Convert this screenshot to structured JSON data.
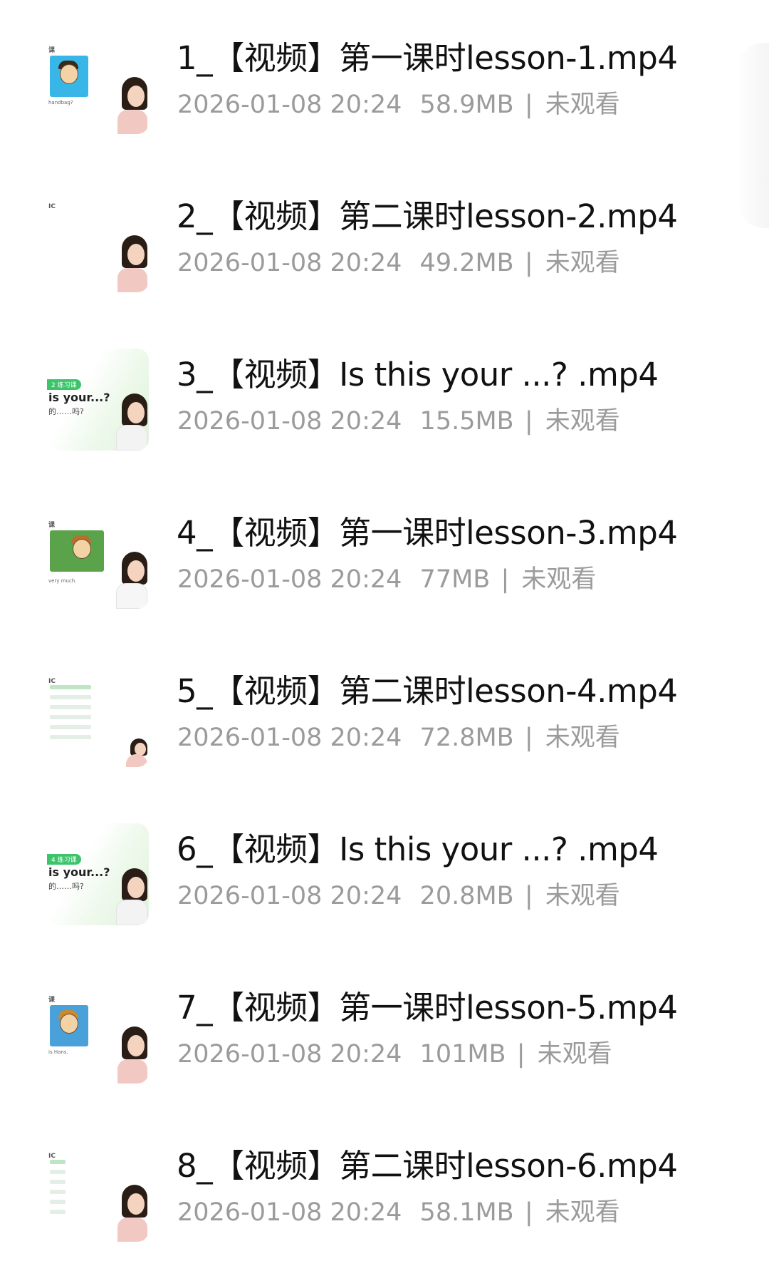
{
  "files": [
    {
      "name": "1_【视频】第一课时lesson-1.mp4",
      "date": "2026-01-08 20:24",
      "size": "58.9MB",
      "status": "未观看",
      "thumb_mark": "课",
      "thumb_caption": "handbag?"
    },
    {
      "name": "2_【视频】第二课时lesson-2.mp4",
      "date": "2026-01-08 20:24",
      "size": "49.2MB",
      "status": "未观看",
      "thumb_mark": "IC"
    },
    {
      "name": "3_【视频】Is this your ...?  .mp4",
      "date": "2026-01-08 20:24",
      "size": "15.5MB",
      "status": "未观看",
      "thumb_badge": "2 练习课",
      "thumb_title": "is your...?",
      "thumb_sub": "的……吗?"
    },
    {
      "name": "4_【视频】第一课时lesson-3.mp4",
      "date": "2026-01-08 20:24",
      "size": "77MB",
      "status": "未观看",
      "thumb_mark": "课",
      "thumb_caption": "very much."
    },
    {
      "name": "5_【视频】第二课时lesson-4.mp4",
      "date": "2026-01-08 20:24",
      "size": "72.8MB",
      "status": "未观看",
      "thumb_mark": "IC"
    },
    {
      "name": "6_【视频】Is this your ...?  .mp4",
      "date": "2026-01-08 20:24",
      "size": "20.8MB",
      "status": "未观看",
      "thumb_badge": "4 练习课",
      "thumb_title": "is your...?",
      "thumb_sub": "的……吗?"
    },
    {
      "name": "7_【视频】第一课时lesson-5.mp4",
      "date": "2026-01-08 20:24",
      "size": "101MB",
      "status": "未观看",
      "thumb_mark": "课",
      "thumb_caption": "is Hans."
    },
    {
      "name": "8_【视频】第二课时lesson-6.mp4",
      "date": "2026-01-08 20:24",
      "size": "58.1MB",
      "status": "未观看",
      "thumb_mark": "IC"
    }
  ],
  "separator": "|",
  "colors": {
    "title_text": "#111111",
    "meta_text": "#9b9b9b",
    "badge_green": "#3bc46a"
  }
}
